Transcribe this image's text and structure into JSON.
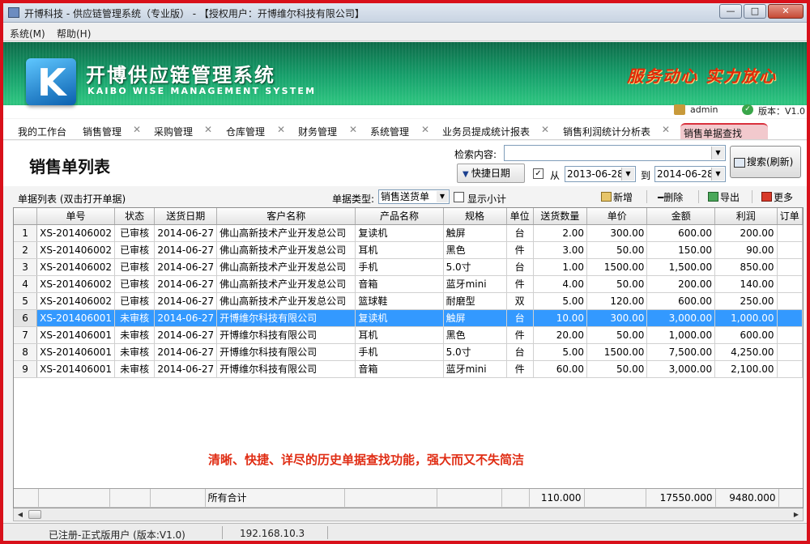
{
  "window": {
    "title": "开博科技 - 供应链管理系统（专业版） - 【授权用户：开博维尔科技有限公司】",
    "min": "—",
    "max": "□",
    "close": "✕"
  },
  "menu": [
    "系统(M)",
    "帮助(H)"
  ],
  "banner": {
    "logo_letter": "K",
    "brand_cn": "开博供应链管理系统",
    "brand_en": "KAIBO WISE MANAGEMENT SYSTEM",
    "slogan": "服务动心 实力放心",
    "user": "admin",
    "version": "版本：V1.0"
  },
  "tabs": [
    {
      "label": "我的工作台",
      "closable": false,
      "active": false
    },
    {
      "label": "销售管理",
      "closable": true,
      "active": false
    },
    {
      "label": "采购管理",
      "closable": true,
      "active": false
    },
    {
      "label": "仓库管理",
      "closable": true,
      "active": false
    },
    {
      "label": "财务管理",
      "closable": true,
      "active": false
    },
    {
      "label": "系统管理",
      "closable": true,
      "active": false
    },
    {
      "label": "业务员提成统计报表",
      "closable": true,
      "active": false
    },
    {
      "label": "销售利润统计分析表",
      "closable": true,
      "active": false
    },
    {
      "label": "销售单据查找",
      "closable": true,
      "active": true
    }
  ],
  "panel": {
    "title": "销售单列表",
    "search_label": "检索内容:",
    "search_value": "",
    "quick_date": "快捷日期",
    "date_enabled": true,
    "from_label": "从",
    "date_from": "2013-06-28",
    "to_label": "到",
    "date_to": "2014-06-28",
    "search_button": "搜索(刷新)"
  },
  "toolbar": {
    "list_label": "单据列表 (双击打开单据)",
    "type_label": "单据类型:",
    "type_value": "销售送货单",
    "subtotal_label": "显示小计",
    "subtotal_checked": false,
    "new": "新增",
    "delete": "删除",
    "export": "导出",
    "more": "更多"
  },
  "grid": {
    "columns": [
      "",
      "单号",
      "状态",
      "送货日期",
      "客户名称",
      "产品名称",
      "规格",
      "单位",
      "送货数量",
      "单价",
      "金额",
      "利润",
      "订单"
    ],
    "rows": [
      [
        "1",
        "XS-201406002",
        "已审核",
        "2014-06-27",
        "佛山高新技术产业开发总公司",
        "复读机",
        "触屏",
        "台",
        "2.00",
        "300.00",
        "600.00",
        "200.00",
        ""
      ],
      [
        "2",
        "XS-201406002",
        "已审核",
        "2014-06-27",
        "佛山高新技术产业开发总公司",
        "耳机",
        "黑色",
        "件",
        "3.00",
        "50.00",
        "150.00",
        "90.00",
        ""
      ],
      [
        "3",
        "XS-201406002",
        "已审核",
        "2014-06-27",
        "佛山高新技术产业开发总公司",
        "手机",
        "5.0寸",
        "台",
        "1.00",
        "1500.00",
        "1,500.00",
        "850.00",
        ""
      ],
      [
        "4",
        "XS-201406002",
        "已审核",
        "2014-06-27",
        "佛山高新技术产业开发总公司",
        "音箱",
        "蓝牙mini",
        "件",
        "4.00",
        "50.00",
        "200.00",
        "140.00",
        ""
      ],
      [
        "5",
        "XS-201406002",
        "已审核",
        "2014-06-27",
        "佛山高新技术产业开发总公司",
        "篮球鞋",
        "耐磨型",
        "双",
        "5.00",
        "120.00",
        "600.00",
        "250.00",
        ""
      ],
      [
        "6",
        "XS-201406001",
        "未审核",
        "2014-06-27",
        "开博维尔科技有限公司",
        "复读机",
        "触屏",
        "台",
        "10.00",
        "300.00",
        "3,000.00",
        "1,000.00",
        ""
      ],
      [
        "7",
        "XS-201406001",
        "未审核",
        "2014-06-27",
        "开博维尔科技有限公司",
        "耳机",
        "黑色",
        "件",
        "20.00",
        "50.00",
        "1,000.00",
        "600.00",
        ""
      ],
      [
        "8",
        "XS-201406001",
        "未审核",
        "2014-06-27",
        "开博维尔科技有限公司",
        "手机",
        "5.0寸",
        "台",
        "5.00",
        "1500.00",
        "7,500.00",
        "4,250.00",
        ""
      ],
      [
        "9",
        "XS-201406001",
        "未审核",
        "2014-06-27",
        "开博维尔科技有限公司",
        "音箱",
        "蓝牙mini",
        "件",
        "60.00",
        "50.00",
        "3,000.00",
        "2,100.00",
        ""
      ]
    ],
    "selected_row": 6,
    "promo": "清晰、快捷、详尽的历史单据查找功能，强大而又不失简洁",
    "totals": {
      "label": "所有合计",
      "quantity": "110.000",
      "amount": "17550.000",
      "profit": "9480.000"
    }
  },
  "status": {
    "registration": "已注册-正式版用户 (版本:V1.0)",
    "ip": "192.168.10.3"
  },
  "colors": {
    "accent_red": "#d9303c",
    "selection": "#3399ff",
    "banner_green": "#16a06b"
  }
}
